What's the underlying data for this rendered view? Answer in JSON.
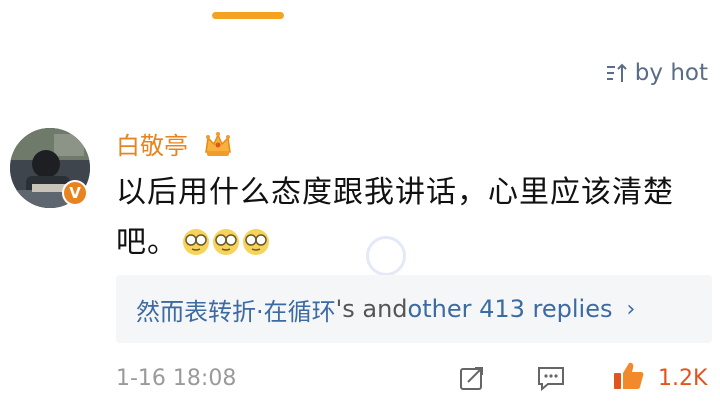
{
  "sort": {
    "label": "by hot",
    "icon": "sort-icon"
  },
  "comment": {
    "username": "白敬亭",
    "badge": "V",
    "crown_icon": "crown-icon",
    "text": "以后用什么态度跟我讲话，心里应该清楚吧。",
    "emojis": [
      "glasses-emoji",
      "glasses-emoji",
      "glasses-emoji"
    ],
    "replies": {
      "names": "然而表转折·在循环",
      "middle": "'s and ",
      "count_text": "other 413 replies",
      "chevron": "›"
    },
    "timestamp": "1-16 18:08",
    "like_count": "1.2K"
  },
  "colors": {
    "accent": "#f4a321",
    "username": "#e8841f",
    "link": "#3c6aa3",
    "like": "#e2541e"
  }
}
